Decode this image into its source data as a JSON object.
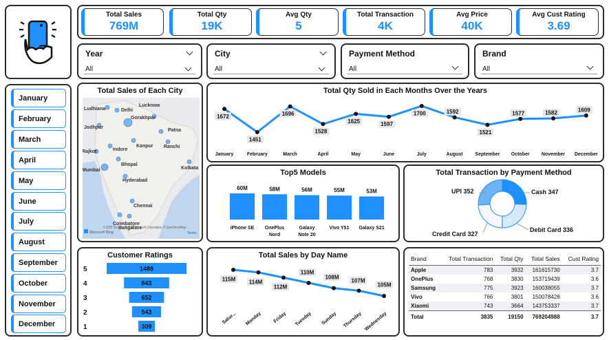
{
  "kpis": [
    {
      "label": "Total Sales",
      "value": "769M"
    },
    {
      "label": "Total Qty",
      "value": "19K"
    },
    {
      "label": "Avg Qty",
      "value": "5"
    },
    {
      "label": "Total Transaction",
      "value": "4K"
    },
    {
      "label": "Avg Price",
      "value": "40K"
    },
    {
      "label": "Avg Cust Rating",
      "value": "3.69"
    }
  ],
  "filters": [
    {
      "title": "Year",
      "value": "All"
    },
    {
      "title": "City",
      "value": "All"
    },
    {
      "title": "Payment Method",
      "value": "All"
    },
    {
      "title": "Brand",
      "value": "All"
    }
  ],
  "months": [
    "January",
    "February",
    "March",
    "April",
    "May",
    "June",
    "July",
    "August",
    "September",
    "October",
    "November",
    "December"
  ],
  "colors": {
    "accent": "#1e90ff",
    "light": "#d6e9fb",
    "border": "#2b2b2b"
  },
  "chart_data": [
    {
      "type": "map",
      "title": "Total Sales of Each City",
      "cities": [
        "Ludhiana",
        "Delhi",
        "Lucknow",
        "Jodhpur",
        "Gorakhpur",
        "Patna",
        "Kanpur",
        "Indore",
        "Rajkot",
        "Ranchi",
        "Bhopal",
        "Mumbai",
        "Kolkata",
        "Hyderabad",
        "Chennai",
        "Coimbatore",
        "Bangalore"
      ],
      "attribution": "© 2025 TomTom, © 2025 Microsoft Corporation, © OpenStreetMap",
      "terms": "Terms",
      "brand": "Microsoft Bing"
    },
    {
      "type": "line",
      "title": "Total Qty Sold in Each Months Over the Years",
      "categories": [
        "January",
        "February",
        "March",
        "April",
        "May",
        "June",
        "July",
        "August",
        "September",
        "October",
        "November",
        "December"
      ],
      "values": [
        1672,
        1451,
        1696,
        1528,
        1625,
        1597,
        1700,
        1592,
        1521,
        1577,
        1582,
        1609
      ]
    },
    {
      "type": "bar",
      "title": "Top5 Models",
      "categories": [
        "iPhone SE",
        "OnePlus Nord",
        "Galaxy Note 20",
        "Vivo Y51",
        "Galaxy S21"
      ],
      "category_lines": [
        [
          "iPhone SE"
        ],
        [
          "OnePlus",
          "Nord"
        ],
        [
          "Galaxy",
          "Note 20"
        ],
        [
          "Vivo Y51"
        ],
        [
          "Galaxy S21"
        ]
      ],
      "values": [
        60,
        58,
        56,
        55,
        53
      ],
      "labels": [
        "60M",
        "58M",
        "56M",
        "55M",
        "53M"
      ]
    },
    {
      "type": "pie",
      "title": "Total Transaction by Payment Method",
      "categories": [
        "Cash",
        "Debit Card",
        "Credit Card",
        "UPI"
      ],
      "values": [
        347,
        336,
        327,
        352
      ],
      "labels": [
        "Cash 347",
        "Debit Card 336",
        "Credit Card 327",
        "UPI 352"
      ]
    },
    {
      "type": "bar",
      "title": "Customer Ratings",
      "categories": [
        "5",
        "4",
        "3",
        "2",
        "1"
      ],
      "values": [
        1488,
        843,
        652,
        543,
        309
      ]
    },
    {
      "type": "line",
      "title": "Total Sales by Day Name",
      "categories": [
        "Satur...",
        "Monday",
        "Friday",
        "Tuesday",
        "Sunday",
        "Thursday",
        "Wednesday"
      ],
      "values": [
        115,
        114,
        112,
        110,
        108,
        107,
        105
      ],
      "labels": [
        "115M",
        "114M",
        "112M",
        "110M",
        "108M",
        "107M",
        "105M"
      ]
    },
    {
      "type": "table",
      "columns": [
        "Brand",
        "Total Transaction",
        "Total Qty",
        "Total Sales",
        "Cust Rating"
      ],
      "rows": [
        [
          "Apple",
          "783",
          "3932",
          "161615730",
          "3.7"
        ],
        [
          "OnePlus",
          "768",
          "3830",
          "153719439",
          "3.6"
        ],
        [
          "Samsung",
          "775",
          "3923",
          "160038055",
          "3.7"
        ],
        [
          "Vivo",
          "766",
          "3801",
          "150078428",
          "3.6"
        ],
        [
          "Xiaomi",
          "743",
          "3664",
          "143753337",
          "3.7"
        ]
      ],
      "total": [
        "Total",
        "3835",
        "19150",
        "769204988",
        "3.7"
      ]
    }
  ]
}
